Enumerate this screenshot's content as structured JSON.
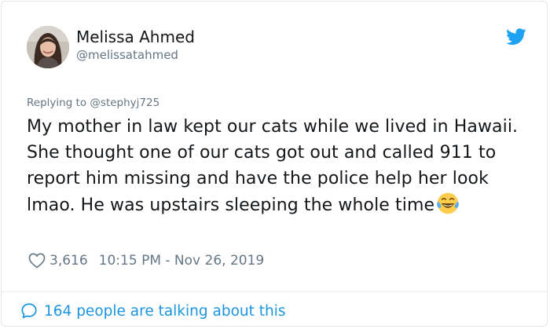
{
  "author": {
    "display_name": "Melissa Ahmed",
    "handle": "@melissatahmed",
    "avatar_icon": "avatar-photo"
  },
  "reply": {
    "prefix": "Replying to",
    "mention": "@stephyj725"
  },
  "tweet": {
    "text": "My mother in law kept our cats while we lived in Hawaii. She thought one of our cats got out and called 911 to report him missing and have the police help her look lmao. He was upstairs sleeping the whole time",
    "emoji_icon": "face-with-tears-of-joy-icon"
  },
  "meta": {
    "likes": "3,616",
    "timestamp": "10:15 PM - Nov 26, 2019"
  },
  "conversation": {
    "label": "164 people are talking about this"
  },
  "colors": {
    "brand": "#1da1f2",
    "link": "#1b95e0",
    "secondary_text": "#657786",
    "primary_text": "#14171a"
  }
}
